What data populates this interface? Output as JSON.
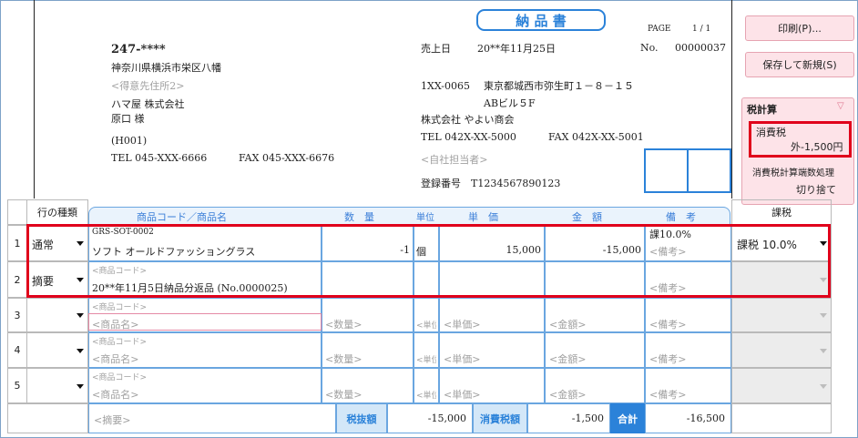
{
  "title": "納 品 書",
  "page": {
    "label": "PAGE",
    "value": "1 / 1"
  },
  "customer": {
    "postal": "247-****",
    "address": "神奈川県横浜市栄区八幡",
    "address2_placeholder": "<得意先住所2>",
    "company": "ハマ屋 株式会社",
    "contact": "原口 様",
    "code": "(H001)",
    "tel": "TEL 045-XXX-6666",
    "fax": "FAX 045-XXX-6676"
  },
  "sale": {
    "date_label": "売上日",
    "date": "20**年11月25日",
    "no_label": "No.",
    "no": "00000037"
  },
  "company": {
    "postal": "1XX-0065",
    "address": "東京都城西市弥生町１－８－１５",
    "building": "ABビル５F",
    "name": "株式会社 やよい商会",
    "tel": "TEL 042X-XX-5000",
    "fax": "FAX 042X-XX-5001",
    "staff_placeholder": "<自社担当者>",
    "reg": "登録番号　T1234567890123"
  },
  "buttons": {
    "print": "印刷(P)...",
    "save_new": "保存して新規(S)"
  },
  "tax_panel": {
    "title": "税計算",
    "consumption_label": "消費税",
    "consumption_value": "外-1,500円",
    "rounding_label": "消費税計算端数処理",
    "rounding_value": "切り捨て"
  },
  "table": {
    "row_type_header": "行の種類",
    "tax_header": "課税",
    "headers": {
      "product": "商品コード／商品名",
      "qty": "数　量",
      "unit": "単位",
      "price": "単　価",
      "amount": "金　額",
      "note": "備　考"
    },
    "rows": [
      {
        "num": "1",
        "type": "通常",
        "code": "GRS-SOT-0002",
        "name": "ソフト オールドファッショングラス",
        "qty": "-1",
        "unit": "個",
        "price": "15,000",
        "amount": "-15,000",
        "note_top": "課10.0%",
        "note": "<備考>",
        "tax": "課税 10.0%"
      },
      {
        "num": "2",
        "type": "摘要",
        "code": "<商品コード>",
        "name": "20**年11月5日納品分返品 (No.0000025)",
        "qty": "",
        "unit": "",
        "price": "",
        "amount": "",
        "note_top": "",
        "note": "<備考>",
        "tax": ""
      },
      {
        "num": "3",
        "type": "",
        "code": "<商品コード>",
        "name": "<商品名>",
        "qty": "<数量>",
        "unit": "<単位>",
        "price": "<単価>",
        "amount": "<金額>",
        "note_top": "",
        "note": "<備考>",
        "tax": ""
      },
      {
        "num": "4",
        "type": "",
        "code": "<商品コード>",
        "name": "<商品名>",
        "qty": "<数量>",
        "unit": "<単位>",
        "price": "<単価>",
        "amount": "<金額>",
        "note_top": "",
        "note": "<備考>",
        "tax": ""
      },
      {
        "num": "5",
        "type": "",
        "code": "<商品コード>",
        "name": "<商品名>",
        "qty": "<数量>",
        "unit": "<単位>",
        "price": "<単価>",
        "amount": "<金額>",
        "note_top": "",
        "note": "<備考>",
        "tax": ""
      }
    ],
    "footer": {
      "summary_placeholder": "<摘要>",
      "pretax_label": "税抜額",
      "pretax_value": "-15,000",
      "tax_label": "消費税額",
      "tax_value": "-1,500",
      "total_label": "合計",
      "total_value": "-16,500"
    }
  },
  "colors": {
    "accent_blue": "#2b82d9",
    "header_bg": "#eaf3fc",
    "highlight_red": "#e0001b",
    "button_pink": "#fde3e8"
  }
}
